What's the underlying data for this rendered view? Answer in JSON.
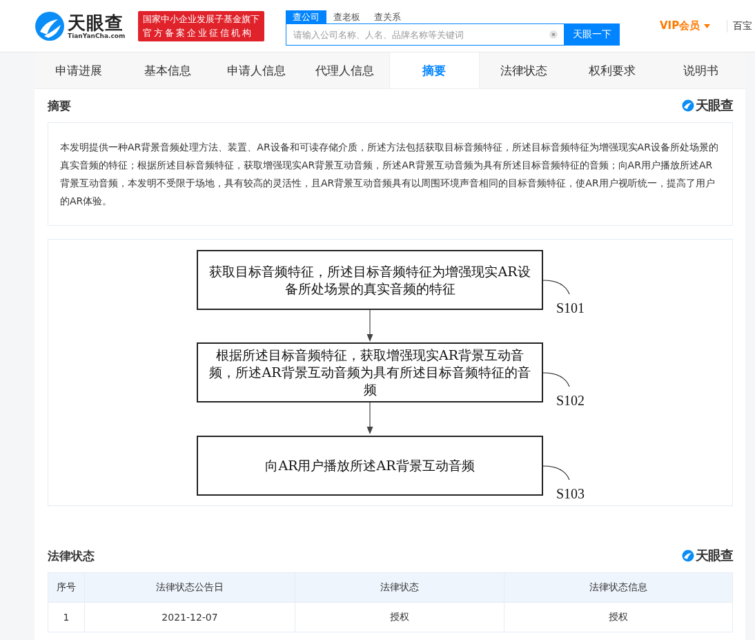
{
  "header": {
    "logo_text": "天眼查",
    "logo_subtext": "TianYanCha.com",
    "badge_lines": [
      "国家中小企业发展子基金旗下",
      "官方备案企业征信机构"
    ],
    "search_tabs": [
      {
        "label": "查公司",
        "selected": true
      },
      {
        "label": "查老板",
        "selected": false
      },
      {
        "label": "查关系",
        "selected": false
      }
    ],
    "search": {
      "placeholder": "请输入公司名称、人名、品牌名称等关键词",
      "button": "天眼一下"
    },
    "vip": "VIP会员",
    "cut_link": "百宝"
  },
  "tabs": [
    {
      "label": "申请进展",
      "selected": false
    },
    {
      "label": "基本信息",
      "selected": false
    },
    {
      "label": "申请人信息",
      "selected": false
    },
    {
      "label": "代理人信息",
      "selected": false
    },
    {
      "label": "摘要",
      "selected": true
    },
    {
      "label": "法律状态",
      "selected": false
    },
    {
      "label": "权利要求",
      "selected": false
    },
    {
      "label": "说明书",
      "selected": false
    }
  ],
  "abstract": {
    "title": "摘要",
    "watermark_logo": "天眼查",
    "text": "本发明提供一种AR背景音频处理方法、装置、AR设备和可读存储介质，所述方法包括获取目标音频特征，所述目标音频特征为增强现实AR设备所处场景的真实音频的特征；根据所述目标音频特征，获取增强现实AR背景互动音频，所述AR背景互动音频为具有所述目标音频特征的音频；向AR用户播放所述AR背景互动音频，本发明不受限于场地，具有较高的灵活性，且AR背景互动音频具有以周围环境声音相同的目标音频特征，使AR用户视听统一，提高了用户的AR体验。",
    "figure_steps": [
      {
        "text": "获取目标音频特征，所述目标音频特征为增强现实AR设备所处场景的真实音频的特征",
        "label": "S101"
      },
      {
        "text": "根据所述目标音频特征，获取增强现实AR背景互动音频，所述AR背景互动音频为具有所述目标音频特征的音频",
        "label": "S102"
      },
      {
        "text": "向AR用户播放所述AR背景互动音频",
        "label": "S103"
      }
    ]
  },
  "legal": {
    "title": "法律状态",
    "watermark_logo": "天眼查",
    "columns": [
      "序号",
      "法律状态公告日",
      "法律状态",
      "法律状态信息"
    ],
    "rows": [
      [
        "1",
        "2021-12-07",
        "授权",
        "授权"
      ]
    ]
  }
}
